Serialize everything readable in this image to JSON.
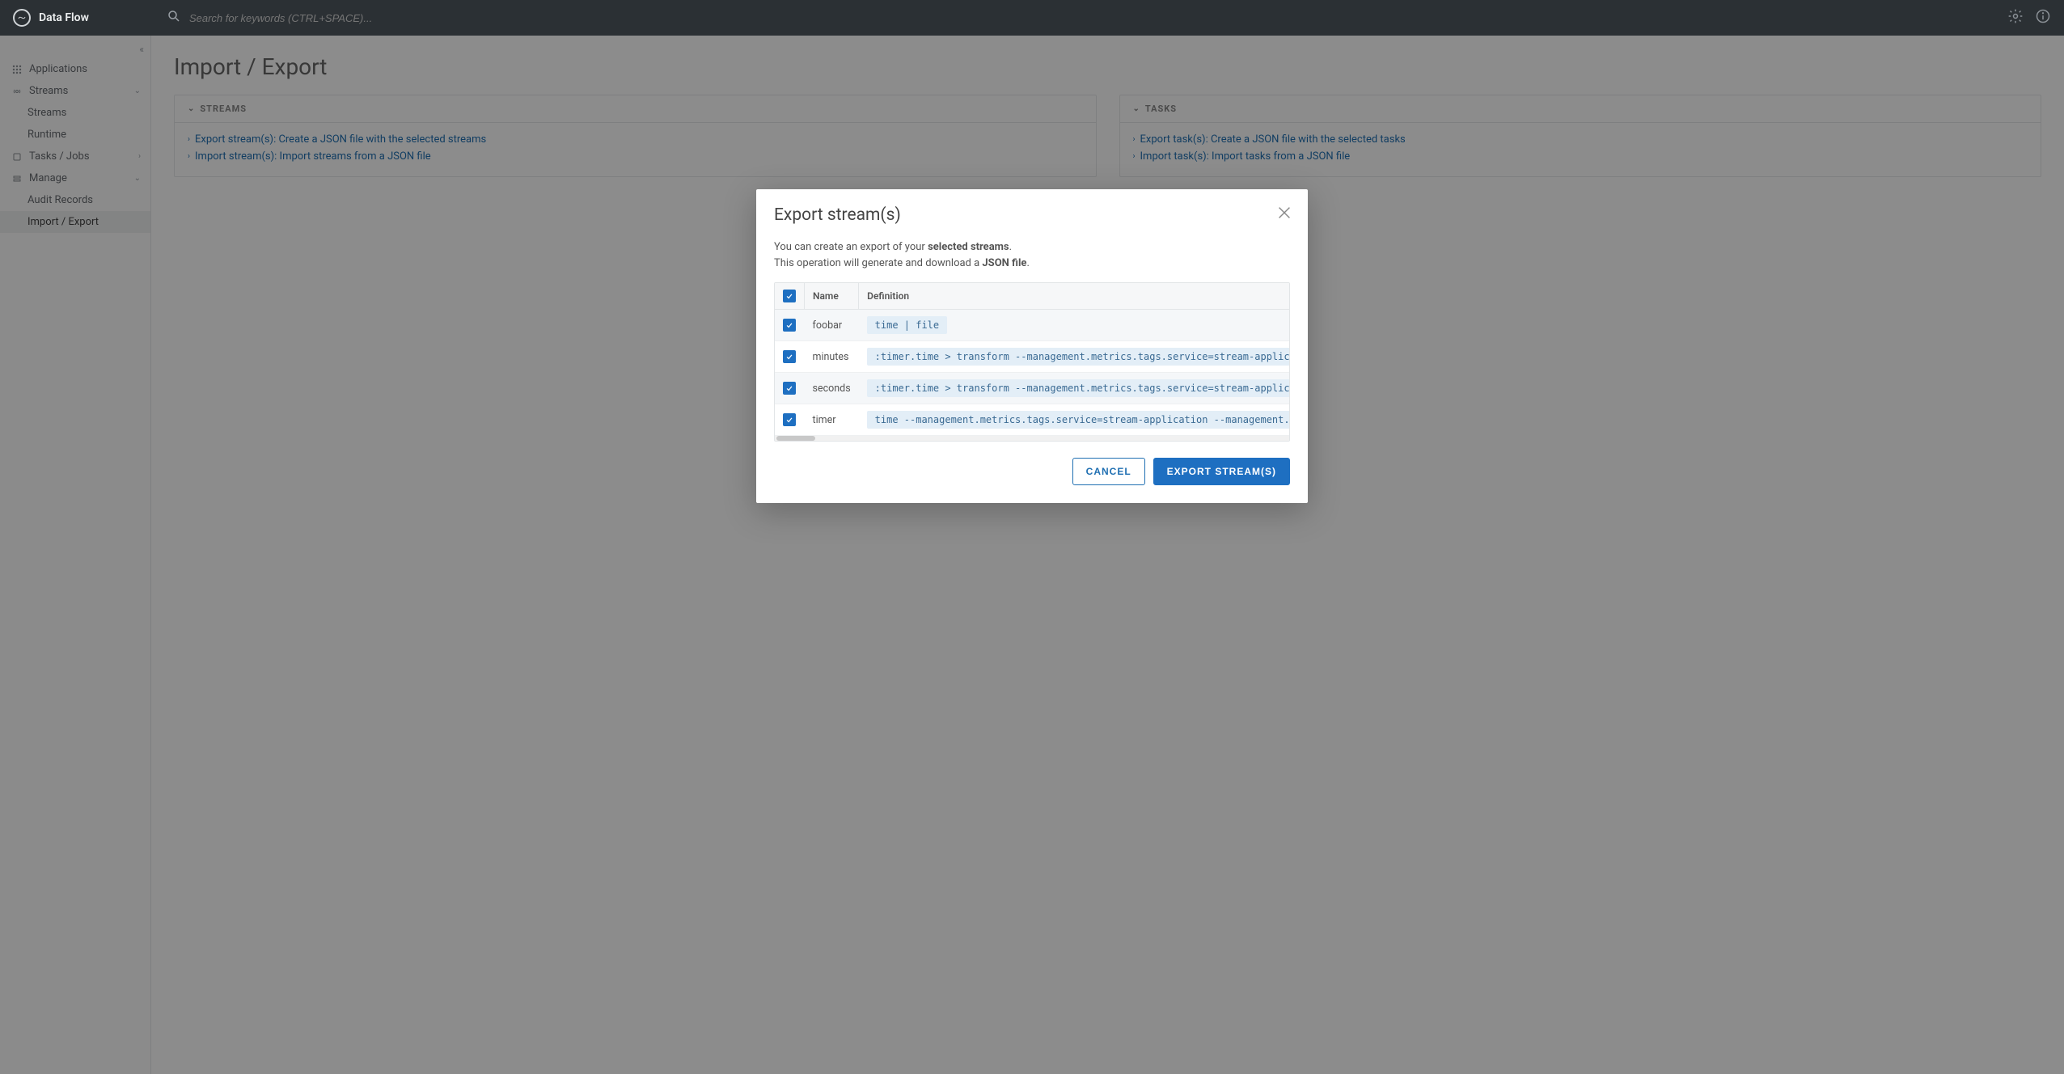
{
  "brand": {
    "name": "Data Flow"
  },
  "search": {
    "placeholder": "Search for keywords (CTRL+SPACE)..."
  },
  "sidebar": {
    "items": [
      {
        "label": "Applications"
      },
      {
        "label": "Streams"
      },
      {
        "label": "Streams"
      },
      {
        "label": "Runtime"
      },
      {
        "label": "Tasks / Jobs"
      },
      {
        "label": "Manage"
      },
      {
        "label": "Audit Records"
      },
      {
        "label": "Import / Export"
      }
    ]
  },
  "page": {
    "title": "Import / Export"
  },
  "panels": {
    "streams": {
      "header": "STREAMS",
      "links": [
        "Export stream(s): Create a JSON file with the selected streams",
        "Import stream(s): Import streams from a JSON file"
      ]
    },
    "tasks": {
      "header": "TASKS",
      "links": [
        "Export task(s): Create a JSON file with the selected tasks",
        "Import task(s): Import tasks from a JSON file"
      ]
    }
  },
  "modal": {
    "title": "Export stream(s)",
    "desc_prefix": "You can create an export of your ",
    "desc_bold1": "selected streams",
    "desc_mid": ".",
    "desc_line2a": "This operation will generate and download a ",
    "desc_bold2": "JSON file",
    "desc_line2b": ".",
    "table": {
      "columns": {
        "name": "Name",
        "definition": "Definition"
      },
      "rows": [
        {
          "name": "foobar",
          "definition": "time | file"
        },
        {
          "name": "minutes",
          "definition": ":timer.time > transform --management.metrics.tags.service=stream-application --management.metrics.tags"
        },
        {
          "name": "seconds",
          "definition": ":timer.time > transform --management.metrics.tags.service=stream-application --management.metrics.tags"
        },
        {
          "name": "timer",
          "definition": "time --management.metrics.tags.service=stream-application --management.metrics.tags.application.type="
        }
      ]
    },
    "actions": {
      "cancel": "CANCEL",
      "export": "EXPORT STREAM(S)"
    }
  }
}
